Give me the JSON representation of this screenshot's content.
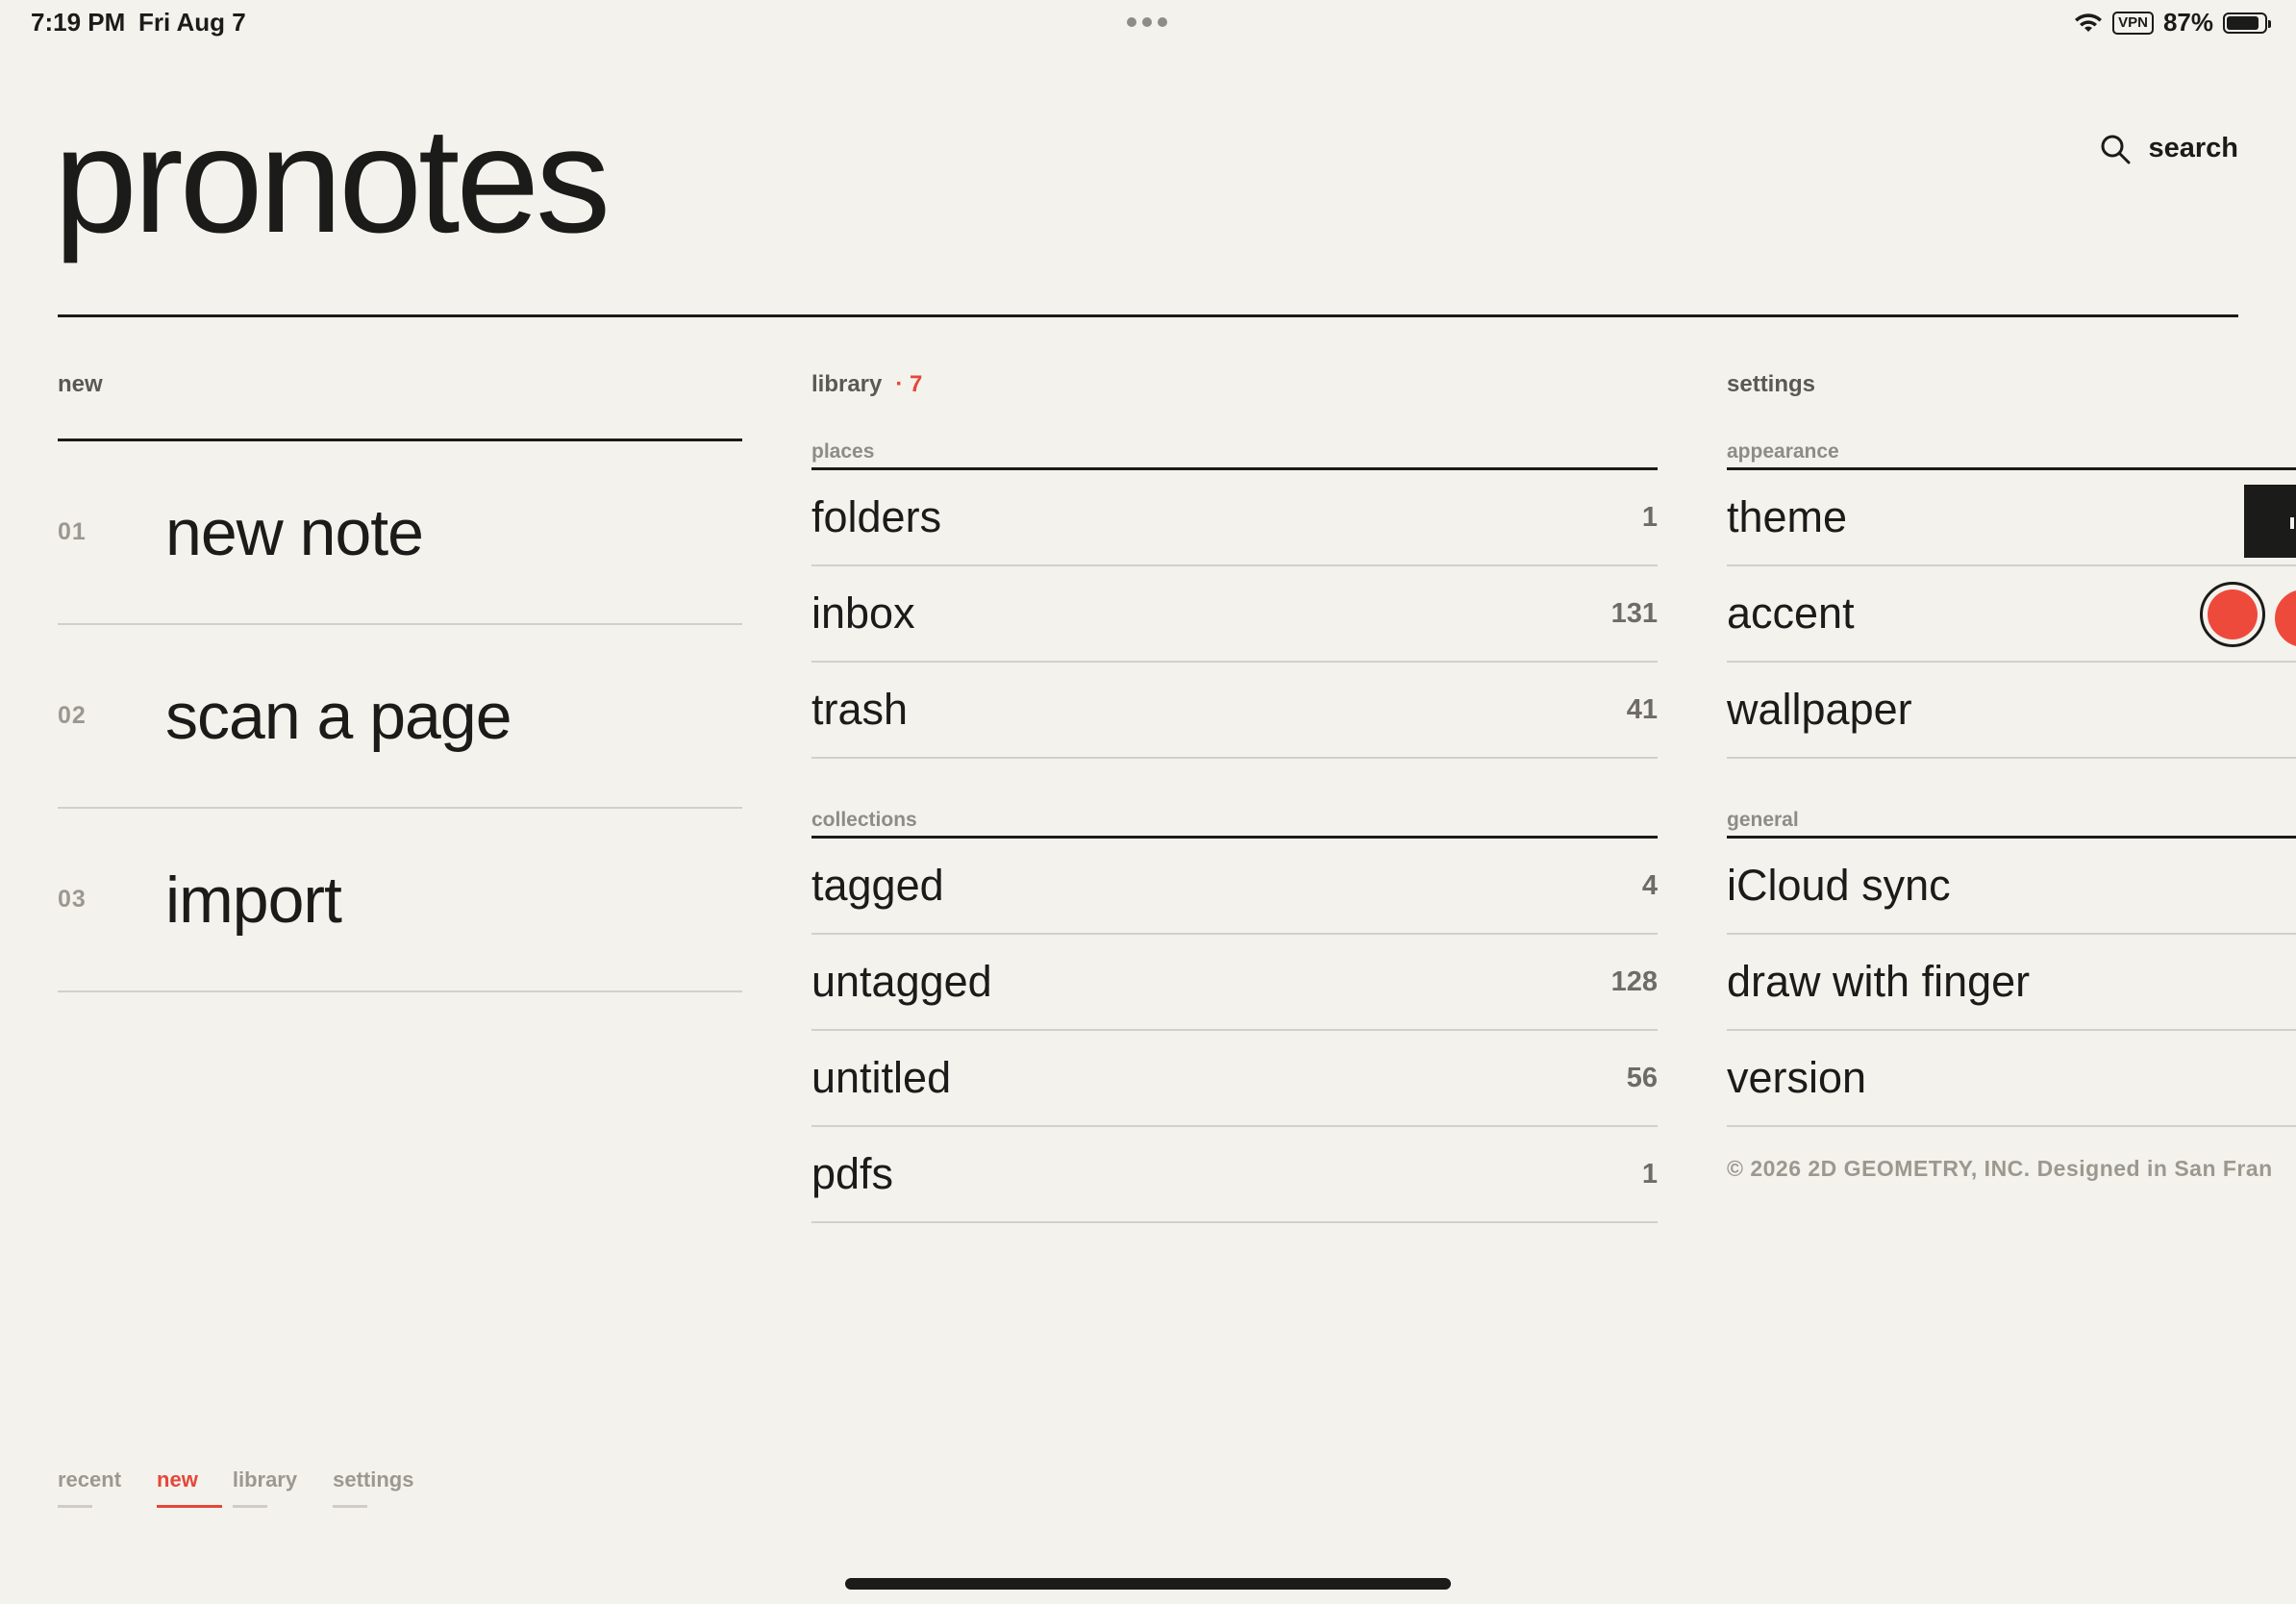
{
  "status_bar": {
    "time": "7:19 PM",
    "date": "Fri Aug 7",
    "vpn": "VPN",
    "battery": "87%",
    "battery_level": 0.87
  },
  "header": {
    "app_title": "pronotes",
    "search_label": "search"
  },
  "new_column": {
    "heading": "new",
    "items": [
      {
        "num": "01",
        "label": "new note"
      },
      {
        "num": "02",
        "label": "scan a page"
      },
      {
        "num": "03",
        "label": "import"
      }
    ]
  },
  "library_column": {
    "heading": "library",
    "badge": "· 7",
    "places_label": "places",
    "places": [
      {
        "label": "folders",
        "count": "1"
      },
      {
        "label": "inbox",
        "count": "131"
      },
      {
        "label": "trash",
        "count": "41"
      }
    ],
    "collections_label": "collections",
    "collections": [
      {
        "label": "tagged",
        "count": "4"
      },
      {
        "label": "untagged",
        "count": "128"
      },
      {
        "label": "untitled",
        "count": "56"
      },
      {
        "label": "pdfs",
        "count": "1"
      }
    ]
  },
  "settings_column": {
    "heading": "settings",
    "appearance_label": "appearance",
    "appearance": [
      {
        "label": "theme"
      },
      {
        "label": "accent"
      },
      {
        "label": "wallpaper"
      }
    ],
    "general_label": "general",
    "general": [
      {
        "label": "iCloud sync"
      },
      {
        "label": "draw with finger"
      },
      {
        "label": "version"
      }
    ],
    "copyright": "© 2026 2D GEOMETRY, INC. Designed in San Fran"
  },
  "bottom_tabs": [
    {
      "label": "recent",
      "active": false
    },
    {
      "label": "new",
      "active": true
    },
    {
      "label": "library",
      "active": false
    },
    {
      "label": "settings",
      "active": false
    }
  ],
  "colors": {
    "background": "#f4f2ed",
    "text": "#1b1b19",
    "accent": "#e5473a",
    "muted": "#9b998f"
  },
  "icons": {
    "search": "search-icon",
    "wifi": "wifi-icon",
    "battery": "battery-icon"
  }
}
